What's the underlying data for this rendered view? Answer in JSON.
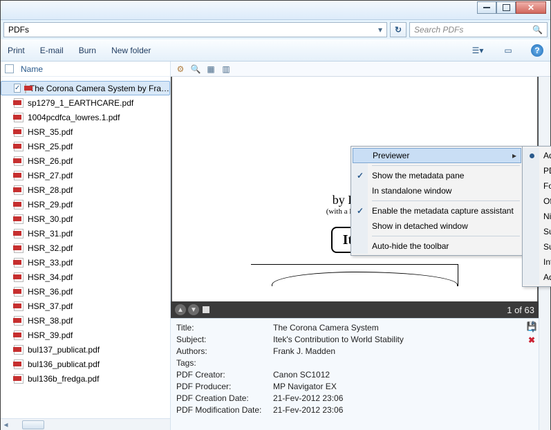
{
  "address": {
    "path": "PDFs"
  },
  "search": {
    "placeholder": "Search PDFs"
  },
  "toolbar": {
    "print": "Print",
    "email": "E-mail",
    "burn": "Burn",
    "new_folder": "New folder"
  },
  "sidebar": {
    "header": "Name",
    "files": [
      {
        "name": "The Corona Camera System by Fra…",
        "selected": true,
        "checked": true
      },
      {
        "name": "sp1279_1_EARTHCARE.pdf"
      },
      {
        "name": "1004pcdfca_lowres.1.pdf"
      },
      {
        "name": "HSR_35.pdf"
      },
      {
        "name": "HSR_25.pdf"
      },
      {
        "name": "HSR_26.pdf"
      },
      {
        "name": "HSR_27.pdf"
      },
      {
        "name": "HSR_28.pdf"
      },
      {
        "name": "HSR_29.pdf"
      },
      {
        "name": "HSR_30.pdf"
      },
      {
        "name": "HSR_31.pdf"
      },
      {
        "name": "HSR_32.pdf"
      },
      {
        "name": "HSR_33.pdf"
      },
      {
        "name": "HSR_34.pdf"
      },
      {
        "name": "HSR_36.pdf"
      },
      {
        "name": "HSR_37.pdf"
      },
      {
        "name": "HSR_38.pdf"
      },
      {
        "name": "HSR_39.pdf"
      },
      {
        "name": "bul137_publicat.pdf"
      },
      {
        "name": "bul136_publicat.pdf"
      },
      {
        "name": "bul136b_fredga.pdf"
      }
    ]
  },
  "context_menu": {
    "previewer": "Previewer",
    "show_metadata": "Show the metadata pane",
    "standalone": "In standalone window",
    "enable_capture": "Enable the metadata capture assistant",
    "detached": "Show in detached window",
    "autohide": "Auto-hide the toolbar"
  },
  "previewer_submenu": {
    "items": [
      {
        "label": "Adobe PDF Preview Handler for Vista",
        "selected": true
      },
      {
        "label": "PDF-XChange PDF Preview Provider"
      },
      {
        "label": "Foxit PDF Preview Handler"
      },
      {
        "label": "Official Foxit PDF Preview Handler"
      },
      {
        "label": "Nitro PDF Preview Handler"
      },
      {
        "label": "SumatraPDF Preview (*.pdf)"
      },
      {
        "label": "Sumatra PDF"
      },
      {
        "label": "Internet Explorer assigned PDF reader"
      },
      {
        "label": "Adobe Acrobat plugin"
      }
    ]
  },
  "preview": {
    "byline": "by Fra…",
    "helpline": "(with a lot of help)",
    "logo": "Itek",
    "page_counter": "1 of 63"
  },
  "metadata": {
    "rows": [
      {
        "k": "Title:",
        "v": "The Corona Camera System"
      },
      {
        "k": "Subject:",
        "v": "Itek's Contribution to World Stability"
      },
      {
        "k": "Authors:",
        "v": "Frank J. Madden"
      },
      {
        "k": "Tags:",
        "v": ""
      },
      {
        "k": "PDF Creator:",
        "v": "Canon SC1012"
      },
      {
        "k": "PDF Producer:",
        "v": "MP Navigator EX"
      },
      {
        "k": "PDF Creation Date:",
        "v": "21-Fev-2012 23:06"
      },
      {
        "k": "PDF Modification Date:",
        "v": "21-Fev-2012 23:06"
      }
    ]
  }
}
